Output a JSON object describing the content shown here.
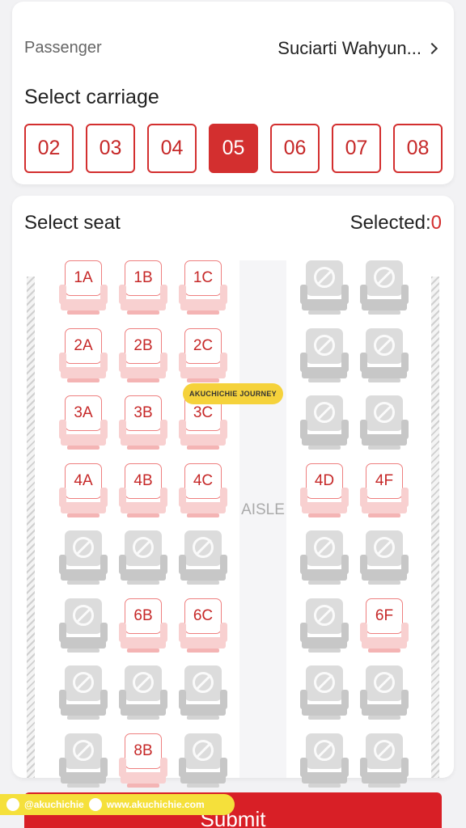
{
  "passenger": {
    "label": "Passenger",
    "name": "Suciarti Wahyun..."
  },
  "carriage": {
    "title": "Select carriage",
    "options": [
      "02",
      "03",
      "04",
      "05",
      "06",
      "07",
      "08"
    ],
    "selected": "05"
  },
  "seat_map": {
    "title": "Select seat",
    "selected_label": "Selected:",
    "selected_count": "0",
    "aisle_label": "AISLE",
    "rows": [
      {
        "A": "1A",
        "B": "1B",
        "C": "1C",
        "D": null,
        "F": null
      },
      {
        "A": "2A",
        "B": "2B",
        "C": "2C",
        "D": null,
        "F": null
      },
      {
        "A": "3A",
        "B": "3B",
        "C": "3C",
        "D": null,
        "F": null
      },
      {
        "A": "4A",
        "B": "4B",
        "C": "4C",
        "D": "4D",
        "F": "4F"
      },
      {
        "A": null,
        "B": null,
        "C": null,
        "D": null,
        "F": null
      },
      {
        "A": null,
        "B": "6B",
        "C": "6C",
        "D": null,
        "F": "6F"
      },
      {
        "A": null,
        "B": null,
        "C": null,
        "D": null,
        "F": null
      },
      {
        "A": null,
        "B": "8B",
        "C": null,
        "D": null,
        "F": null
      }
    ]
  },
  "submit_label": "Submit",
  "watermark": {
    "handle": "@akuchichie",
    "website": "www.akuchichie.com",
    "logo_text": "AKUCHICHIE JOURNEY"
  },
  "colors": {
    "accent": "#d32f2f",
    "unavailable": "#dcdcdc"
  }
}
